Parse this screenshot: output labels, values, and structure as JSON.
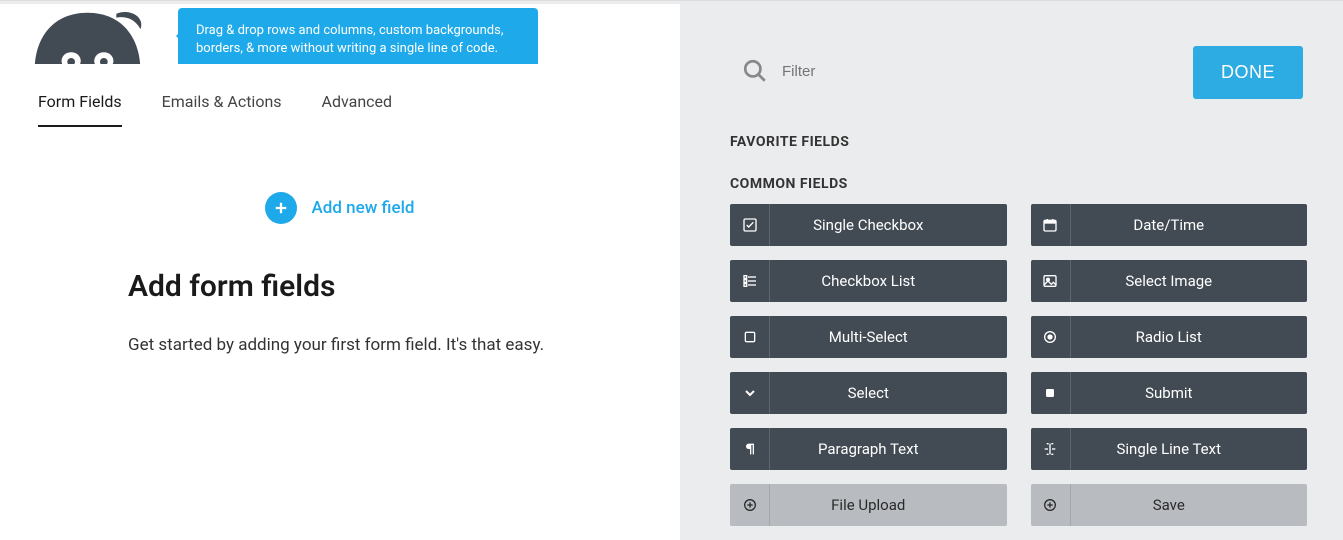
{
  "tooltip": "Drag & drop rows and columns, custom backgrounds, borders, & more without writing a single line of code.",
  "tabs": {
    "form_fields": "Form Fields",
    "emails_actions": "Emails & Actions",
    "advanced": "Advanced"
  },
  "add_new": "Add new field",
  "heading": "Add form fields",
  "subtext": "Get started by adding your first form field. It's that easy.",
  "filter": {
    "placeholder": "Filter"
  },
  "done": "DONE",
  "sections": {
    "favorite": "FAVORITE FIELDS",
    "common": "COMMON FIELDS"
  },
  "fields": {
    "single_checkbox": "Single Checkbox",
    "date_time": "Date/Time",
    "checkbox_list": "Checkbox List",
    "select_image": "Select Image",
    "multi_select": "Multi-Select",
    "radio_list": "Radio List",
    "select": "Select",
    "submit": "Submit",
    "paragraph_text": "Paragraph Text",
    "single_line_text": "Single Line Text",
    "file_upload": "File Upload",
    "save": "Save"
  }
}
